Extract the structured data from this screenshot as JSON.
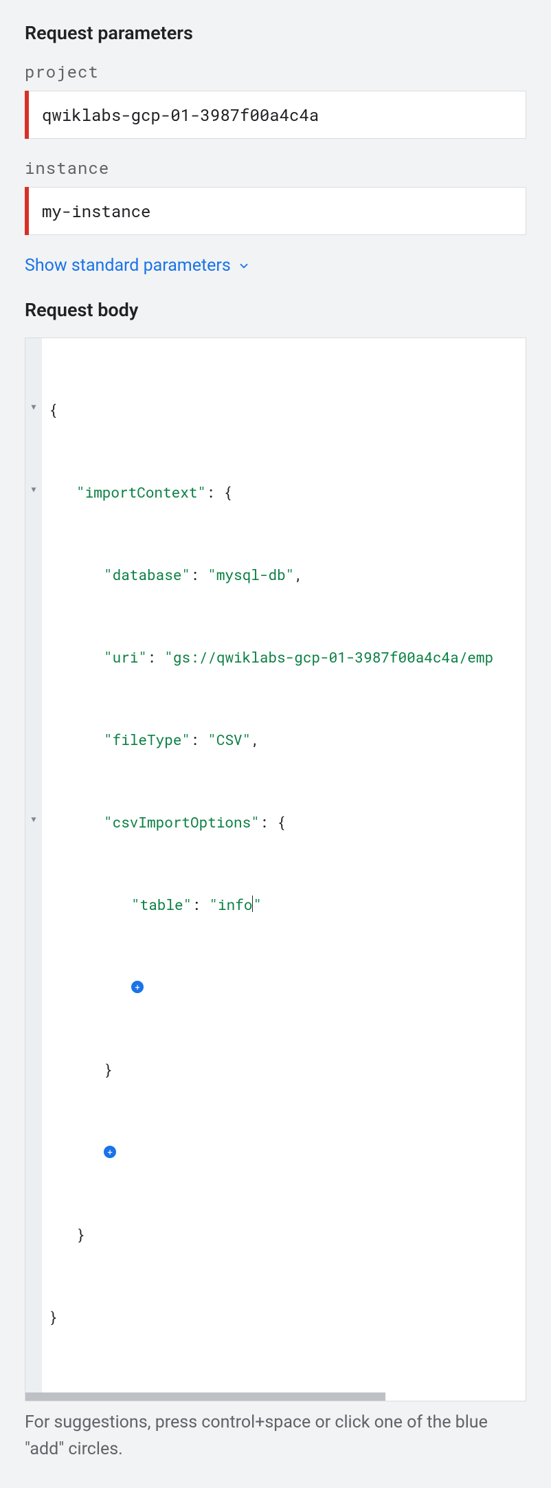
{
  "sections": {
    "params_heading": "Request parameters",
    "body_heading": "Request body"
  },
  "params": {
    "project": {
      "label": "project",
      "value": "qwiklabs-gcp-01-3987f00a4c4a"
    },
    "instance": {
      "label": "instance",
      "value": "my-instance"
    }
  },
  "links": {
    "show_standard": "Show standard parameters"
  },
  "body_json": {
    "keys": {
      "importContext": "\"importContext\"",
      "database": "\"database\"",
      "uri": "\"uri\"",
      "fileType": "\"fileType\"",
      "csvImportOptions": "\"csvImportOptions\"",
      "table": "\"table\""
    },
    "values": {
      "database": "\"mysql-db\"",
      "uri": "\"gs://qwiklabs-gcp-01-3987f00a4c4a/emp",
      "fileType": "\"CSV\"",
      "table_open": "\"info",
      "table_close": "\""
    },
    "punct": {
      "open_brace": "{",
      "close_brace": "}",
      "colon_sp": ": ",
      "comma": ","
    }
  },
  "hint": "For suggestions, press control+space or click one of the blue \"add\" circles."
}
